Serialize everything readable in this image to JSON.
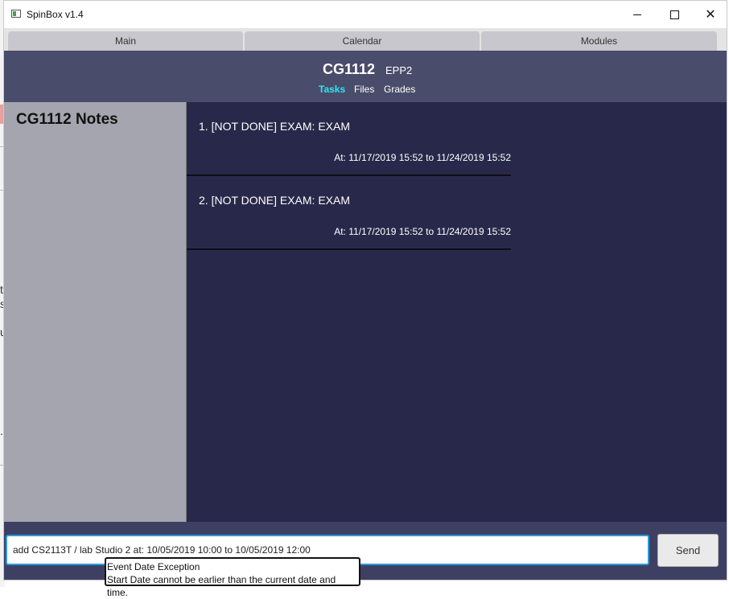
{
  "window": {
    "title": "SpinBox v1.4",
    "controls": {
      "minimize": "minimize",
      "maximize": "maximize",
      "close": "✕"
    }
  },
  "top_tabs": [
    "Main",
    "Calendar",
    "Modules"
  ],
  "module": {
    "code": "CG1112",
    "name": "EPP2",
    "sub_tabs": [
      "Tasks",
      "Files",
      "Grades"
    ],
    "active_sub_tab": "Tasks"
  },
  "notes": {
    "title": "CG1112 Notes"
  },
  "tasks": [
    {
      "title": "1. [NOT DONE] EXAM: EXAM",
      "date": "At: 11/17/2019 15:52 to 11/24/2019 15:52"
    },
    {
      "title": "2. [NOT DONE] EXAM: EXAM",
      "date": "At: 11/17/2019 15:52 to 11/24/2019 15:52"
    }
  ],
  "command": {
    "value": "add CS2113T / lab Studio 2 at: 10/05/2019 10:00 to 10/05/2019 12:00",
    "send_label": "Send"
  },
  "error_tooltip": {
    "title": "Event Date Exception",
    "message": "Start Date cannot be earlier than the current date and time."
  },
  "background_glyphs": [
    "t",
    "s",
    "u",
    "."
  ],
  "colors": {
    "accent_tab": "#2ee6f0",
    "tasks_bg": "#28294a",
    "header_bg": "#4a4c6b",
    "notes_bg": "#a4a5ae",
    "input_focus": "#2b9ad6"
  }
}
